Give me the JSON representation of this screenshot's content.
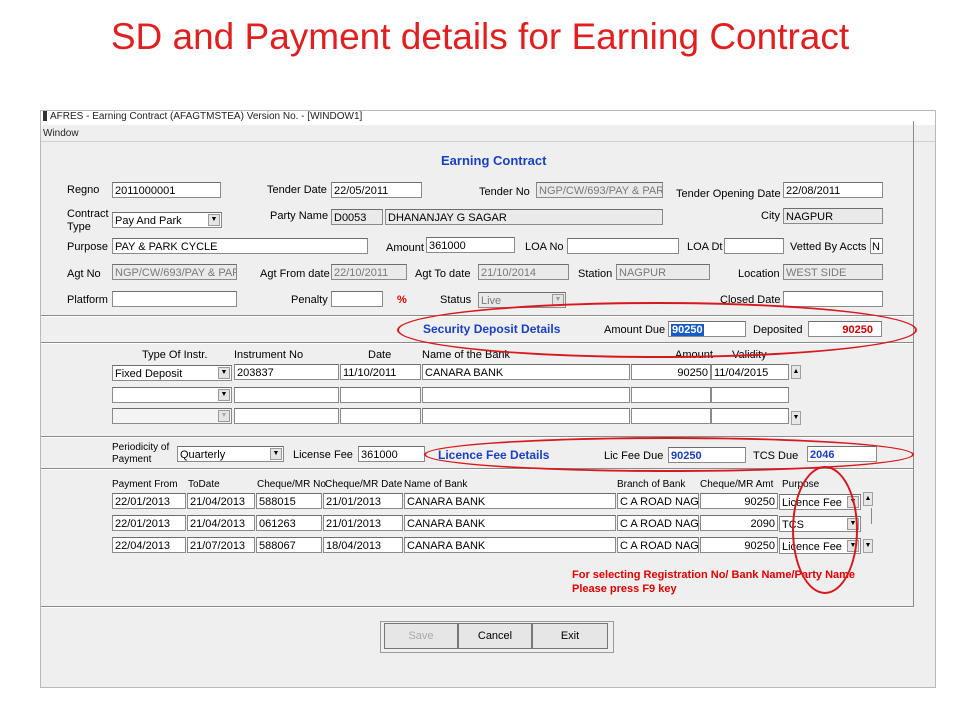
{
  "slide_title": "SD and Payment details for Earning Contract",
  "window": {
    "titlebar": "AFRES - Earning Contract (AFAGTMSTEA) Version No.  - [WINDOW1]",
    "menu": "Window",
    "form_title": "Earning Contract"
  },
  "header": {
    "regno_label": "Regno",
    "regno": "2011000001",
    "tender_date_label": "Tender Date",
    "tender_date": "22/05/2011",
    "tender_no_label": "Tender No",
    "tender_no": "NGP/CW/693/PAY & PAR",
    "tender_open_label": "Tender Opening Date",
    "tender_open": "22/08/2011",
    "contract_type_label": "Contract Type",
    "contract_type": "Pay And Park",
    "party_name_label": "Party Name",
    "party_code": "D0053",
    "party_name": "DHANANJAY G SAGAR",
    "city_label": "City",
    "city": "NAGPUR",
    "purpose_label": "Purpose",
    "purpose": "PAY & PARK CYCLE",
    "amount_label": "Amount",
    "amount": "361000",
    "loa_no_label": "LOA No",
    "loa_no": "",
    "loa_dt_label": "LOA Dt",
    "loa_dt": "",
    "vetted_label": "Vetted By Accts",
    "vetted": "N",
    "agt_no_label": "Agt No",
    "agt_no": "NGP/CW/693/PAY & PAR",
    "agt_from_label": "Agt From date",
    "agt_from": "22/10/2011",
    "agt_to_label": "Agt To date",
    "agt_to": "21/10/2014",
    "station_label": "Station",
    "station": "NAGPUR",
    "location_label": "Location",
    "location": "WEST SIDE",
    "platform_label": "Platform",
    "platform": "",
    "penalty_label": "Penalty",
    "penalty": "",
    "penalty_unit": "%",
    "status_label": "Status",
    "status": "Live",
    "closed_date_label": "Closed Date",
    "closed_date": ""
  },
  "security_deposit": {
    "title": "Security Deposit Details",
    "amount_due_label": "Amount Due",
    "amount_due": "90250",
    "deposited_label": "Deposited",
    "deposited": "90250",
    "columns": [
      "Type Of Instr.",
      "Instrument No",
      "Date",
      "Name of the Bank",
      "Amount",
      "Validity"
    ],
    "rows": [
      {
        "type": "Fixed Deposit",
        "instrument_no": "203837",
        "date": "11/10/2011",
        "bank": "CANARA BANK",
        "amount": "90250",
        "validity": "11/04/2015"
      },
      {
        "type": "",
        "instrument_no": "",
        "date": "",
        "bank": "",
        "amount": "",
        "validity": ""
      },
      {
        "type": "",
        "instrument_no": "",
        "date": "",
        "bank": "",
        "amount": "",
        "validity": ""
      }
    ]
  },
  "licence_fee": {
    "periodicity_label": "Periodicity of Payment",
    "periodicity": "Quarterly",
    "license_fee_label": "License Fee",
    "license_fee": "361000",
    "title": "Licence Fee Details",
    "lic_fee_due_label": "Lic Fee Due",
    "lic_fee_due": "90250",
    "tcs_due_label": "TCS Due",
    "tcs_due": "2046"
  },
  "payments": {
    "columns": [
      "Payment From",
      "ToDate",
      "Cheque/MR No",
      "Cheque/MR Date",
      "Name of Bank",
      "Branch of Bank",
      "Cheque/MR Amt",
      "Purpose"
    ],
    "rows": [
      {
        "from": "22/01/2013",
        "to": "21/04/2013",
        "cheque_no": "588015",
        "cheque_date": "21/01/2013",
        "bank": "CANARA BANK",
        "branch": "C A ROAD NAGF",
        "amount": "90250",
        "purpose": "Licence Fee"
      },
      {
        "from": "22/01/2013",
        "to": "21/04/2013",
        "cheque_no": "061263",
        "cheque_date": "21/01/2013",
        "bank": "CANARA BANK",
        "branch": "C A ROAD NAGF",
        "amount": "2090",
        "purpose": "TCS"
      },
      {
        "from": "22/04/2013",
        "to": "21/07/2013",
        "cheque_no": "588067",
        "cheque_date": "18/04/2013",
        "bank": "CANARA BANK",
        "branch": "C A ROAD NAGF",
        "amount": "90250",
        "purpose": "Licence Fee"
      }
    ]
  },
  "note": {
    "line1": "For selecting Registration No/ Bank Name/Party Name",
    "line2": "Please press F9 key"
  },
  "buttons": {
    "save": "Save",
    "cancel": "Cancel",
    "exit": "Exit"
  },
  "colors": {
    "annotation_red": "#d8181c",
    "title_red": "#e02020",
    "form_blue": "#1a3fc0"
  }
}
